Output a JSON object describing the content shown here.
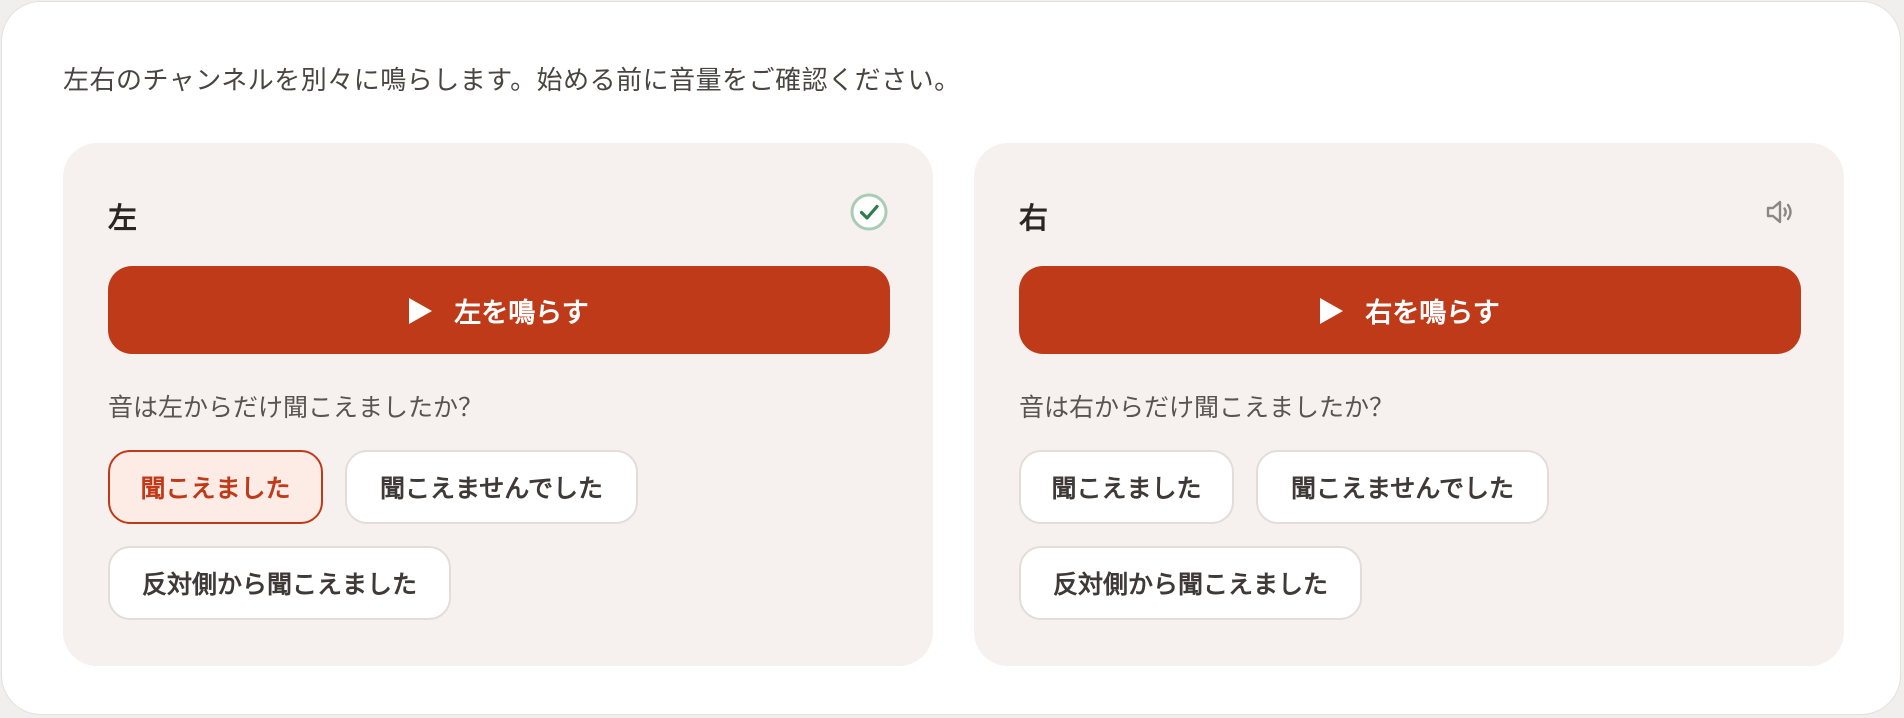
{
  "intro": "左右のチャンネルを別々に鳴らします。始める前に音量をご確認ください。",
  "colors": {
    "accent": "#bf3a19",
    "panel_bg": "#f6f1ee",
    "success": "#2e7d4a"
  },
  "channels": [
    {
      "title": "左",
      "status_icon": "check-circle-icon",
      "play_label": "左を鳴らす",
      "question": "音は左からだけ聞こえましたか？",
      "answers": [
        "聞こえました",
        "聞こえませんでした",
        "反対側から聞こえました"
      ],
      "selected_answer": "聞こえました"
    },
    {
      "title": "右",
      "status_icon": "speaker-icon",
      "play_label": "右を鳴らす",
      "question": "音は右からだけ聞こえましたか？",
      "answers": [
        "聞こえました",
        "聞こえませんでした",
        "反対側から聞こえました"
      ],
      "selected_answer": ""
    }
  ]
}
